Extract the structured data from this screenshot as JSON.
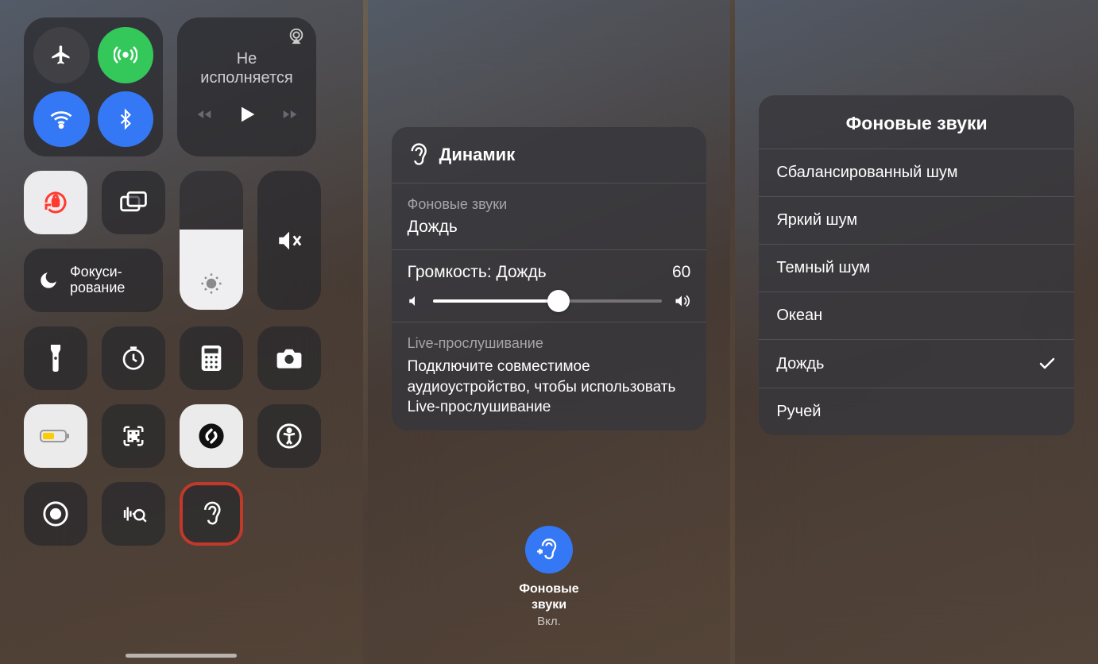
{
  "screen1": {
    "media": {
      "title": "Не\nисполняется"
    },
    "focus": {
      "label": "Фокуси-\nрование"
    }
  },
  "screen2": {
    "header": "Динамик",
    "bgSoundsLabel": "Фоновые звуки",
    "bgSoundsValue": "Дождь",
    "volumeLabel": "Громкость: Дождь",
    "volumeValue": "60",
    "liveLabel": "Live-прослушивание",
    "liveText": "Подключите совместимое аудиоустройство, чтобы использовать Live-прослушивание",
    "button": {
      "label": "Фоновые\nзвуки",
      "status": "Вкл."
    }
  },
  "screen3": {
    "title": "Фоновые звуки",
    "items": [
      {
        "label": "Сбалансированный шум",
        "selected": false
      },
      {
        "label": "Яркий шум",
        "selected": false
      },
      {
        "label": "Темный шум",
        "selected": false
      },
      {
        "label": "Океан",
        "selected": false
      },
      {
        "label": "Дождь",
        "selected": true
      },
      {
        "label": "Ручей",
        "selected": false
      }
    ]
  }
}
